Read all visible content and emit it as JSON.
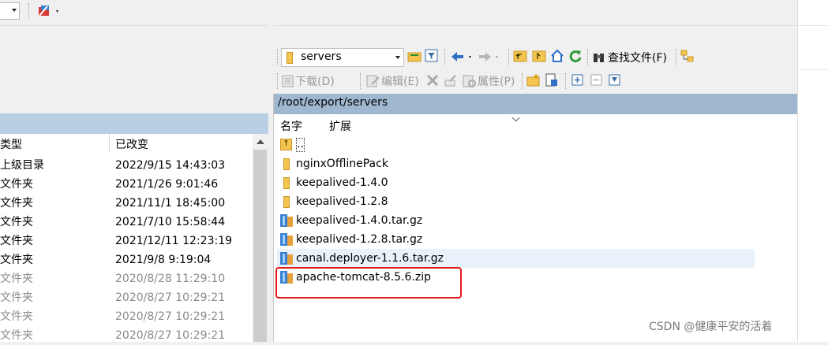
{
  "toolbar_right": {
    "path_value": "servers",
    "find_files": "查找文件(F)",
    "download": "下载(D)",
    "edit": "编辑(E)",
    "properties": "属性(P)"
  },
  "right_pane": {
    "path": "/root/export/servers",
    "col_name": "名字",
    "col_ext": "扩展",
    "parent": "..",
    "files": [
      {
        "name": "nginxOfflinePack",
        "type": "folder"
      },
      {
        "name": "keepalived-1.4.0",
        "type": "folder"
      },
      {
        "name": "keepalived-1.2.8",
        "type": "folder"
      },
      {
        "name": "keepalived-1.4.0.tar.gz",
        "type": "archive"
      },
      {
        "name": "keepalived-1.2.8.tar.gz",
        "type": "archive"
      },
      {
        "name": "canal.deployer-1.1.6.tar.gz",
        "type": "archive"
      },
      {
        "name": "apache-tomcat-8.5.6.zip",
        "type": "archive"
      }
    ]
  },
  "left_pane": {
    "col_type": "类型",
    "col_modified": "已改变",
    "rows": [
      {
        "type": "上级目录",
        "modified": "2022/9/15  14:43:03"
      },
      {
        "type": "文件夹",
        "modified": "2021/1/26  9:01:46"
      },
      {
        "type": "文件夹",
        "modified": "2021/11/1  18:45:00"
      },
      {
        "type": "文件夹",
        "modified": "2021/7/10  15:58:44"
      },
      {
        "type": "文件夹",
        "modified": "2021/12/11  12:23:19"
      },
      {
        "type": "文件夹",
        "modified": "2021/9/8  9:19:04"
      },
      {
        "type": "文件夹",
        "modified": "2020/8/28  11:29:10"
      },
      {
        "type": "文件夹",
        "modified": "2020/8/27  10:29:21"
      },
      {
        "type": "文件夹",
        "modified": "2020/8/27  10:29:21"
      },
      {
        "type": "文件夹",
        "modified": "2020/8/27  10:29:21"
      }
    ]
  },
  "watermark": "CSDN @健康平安的活着",
  "colors": {
    "left_header": "#b9cfe3",
    "path_bar": "#9fb8d0",
    "highlight": "#e21a1a",
    "selected_row": "#e9f2fb"
  }
}
